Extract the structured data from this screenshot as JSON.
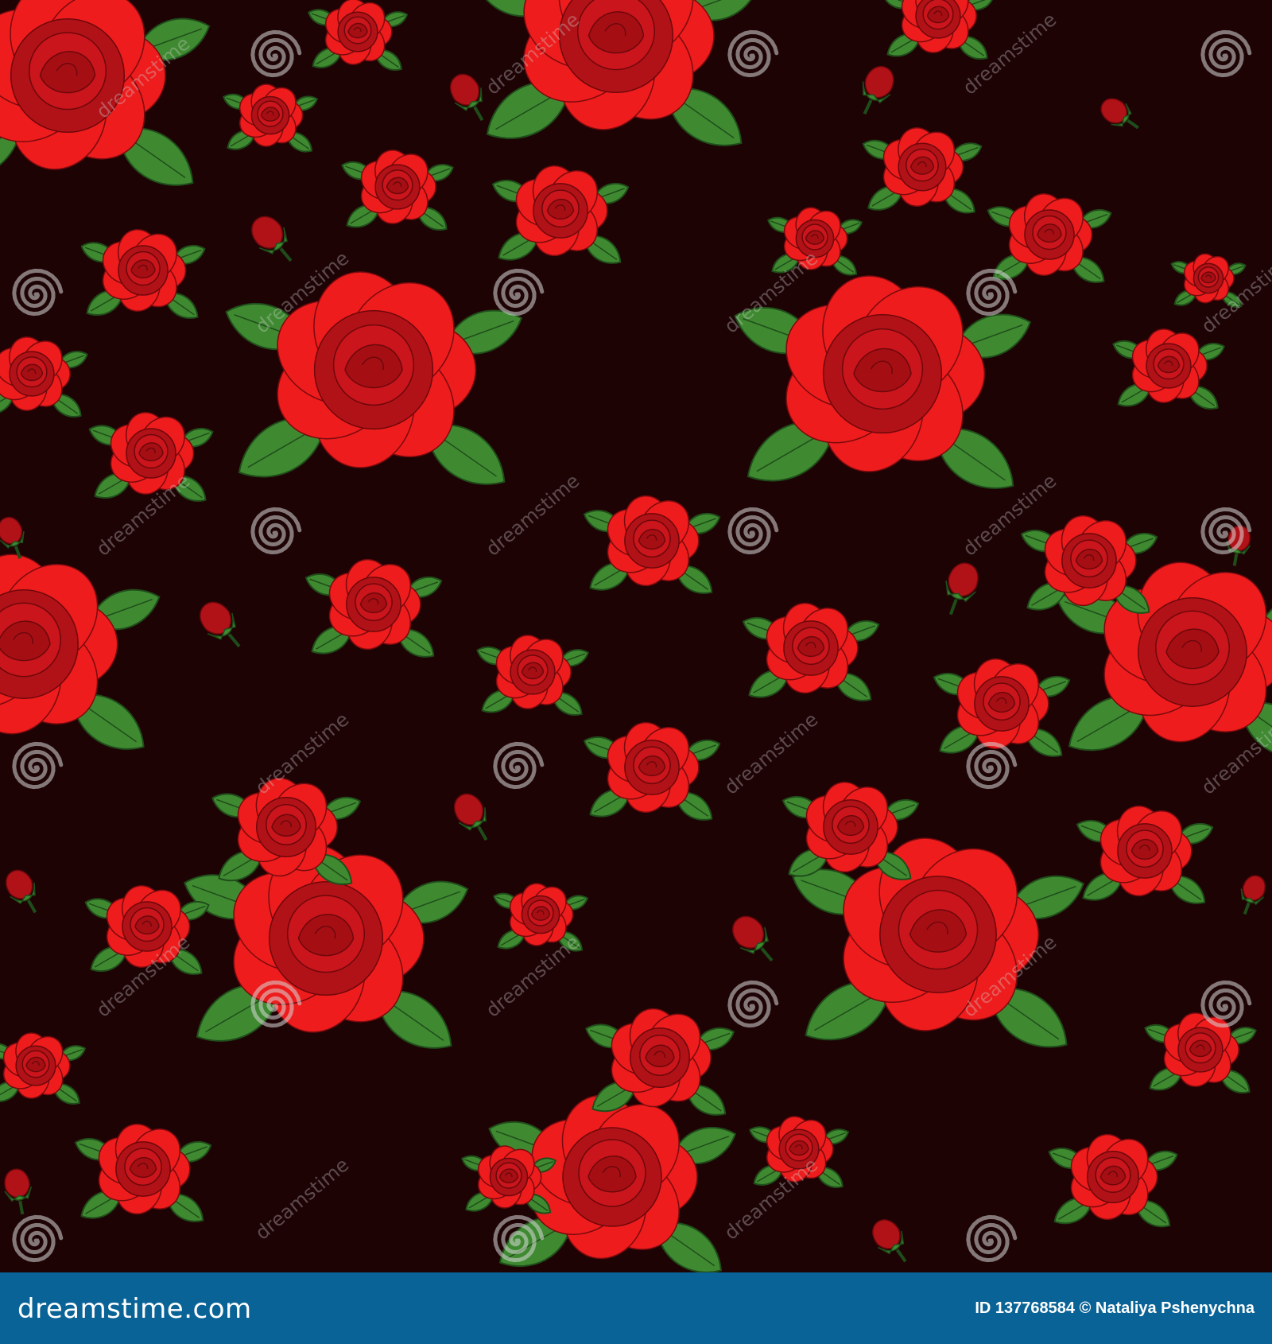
{
  "image": {
    "description_colors": {
      "background": "#1e0305",
      "petal_light": "#ee1c1c",
      "petal_dark": "#b11217",
      "leaf": "#3f8a31",
      "leaf_dark": "#1f4d1a",
      "footer": "#0a6396"
    },
    "watermark_text": "dreamstime",
    "footer": {
      "site": "dreamstime.com",
      "id_label": "ID",
      "id": "137768584",
      "copyright": "©",
      "author": "Nataliya Pshenychna"
    }
  }
}
